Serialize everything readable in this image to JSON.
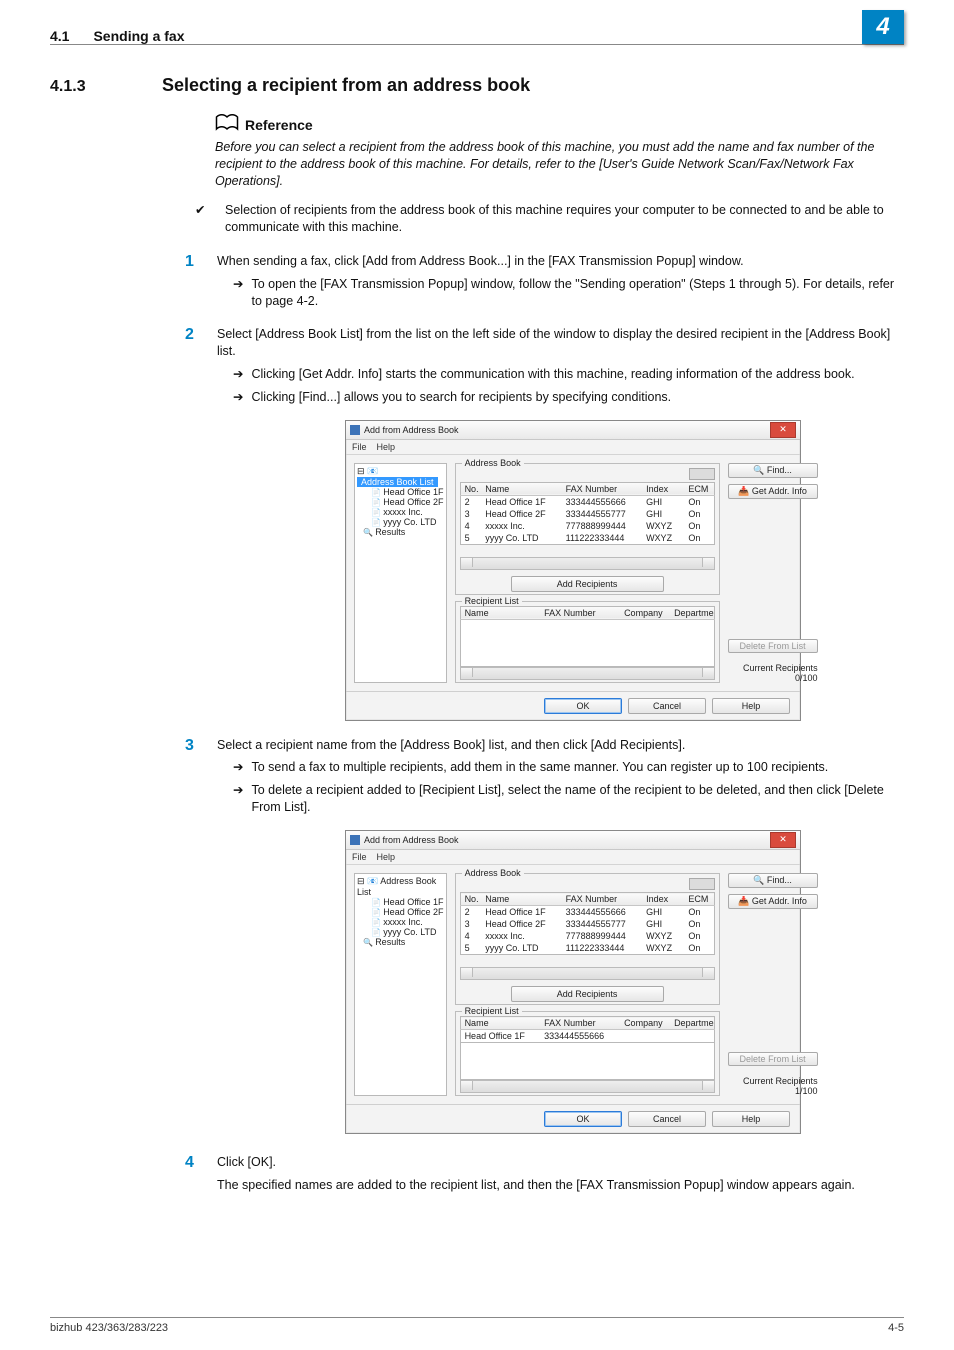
{
  "header": {
    "section_no": "4.1",
    "section_title": "Sending a fax",
    "chapter_badge": "4"
  },
  "section": {
    "number": "4.1.3",
    "title": "Selecting a recipient from an address book"
  },
  "reference": {
    "label": "Reference",
    "body": "Before you can select a recipient from the address book of this machine, you must add the name and fax number of the recipient to the address book of this machine. For details, refer to the [User's Guide Network Scan/Fax/Network Fax Operations]."
  },
  "bullet": {
    "text": "Selection of recipients from the address book of this machine requires your computer to be connected to and be able to communicate with this machine."
  },
  "steps": {
    "s1": {
      "num": "1",
      "text": "When sending a fax, click [Add from Address Book...] in the [FAX Transmission Popup] window.",
      "sub1": "To open the [FAX Transmission Popup] window, follow the \"Sending operation\" (Steps 1 through 5). For details, refer to page 4-2."
    },
    "s2": {
      "num": "2",
      "text": "Select [Address Book List] from the list on the left side of the window to display the desired recipient in the [Address Book] list.",
      "sub1": "Clicking [Get Addr. Info] starts the communication with this machine, reading information of the address book.",
      "sub2": "Clicking [Find...] allows you to search for recipients by specifying conditions."
    },
    "s3": {
      "num": "3",
      "text": "Select a recipient name from the [Address Book] list, and then click [Add Recipients].",
      "sub1": "To send a fax to multiple recipients, add them in the same manner. You can register up to 100 recipients.",
      "sub2": "To delete a recipient added to [Recipient List], select the name of the recipient to be deleted, and then click [Delete From List]."
    },
    "s4": {
      "num": "4",
      "text": "Click [OK].",
      "body": "The specified names are added to the recipient list, and then the [FAX Transmission Popup] window appears again."
    }
  },
  "dialog_common": {
    "title": "Add from Address Book",
    "menu": {
      "file": "File",
      "help": "Help"
    },
    "tree": {
      "root": "Address Book List",
      "items": [
        "Head Office 1F",
        "Head Office 2F",
        "xxxxx Inc.",
        "yyyy Co. LTD"
      ],
      "results": "Results"
    },
    "group_address": "Address Book",
    "group_recipient": "Recipient List",
    "cols_addr": {
      "no": "No.",
      "name": "Name",
      "fax": "FAX Number",
      "index": "Index",
      "ecm": "ECM"
    },
    "cols_recip": {
      "name": "Name",
      "fax": "FAX Number",
      "company": "Company",
      "dept": "Departmen"
    },
    "rows": [
      {
        "no": "2",
        "name": "Head Office 1F",
        "fax": "333444555666",
        "index": "GHI",
        "ecm": "On"
      },
      {
        "no": "3",
        "name": "Head Office 2F",
        "fax": "333444555777",
        "index": "GHI",
        "ecm": "On"
      },
      {
        "no": "4",
        "name": "xxxxx Inc.",
        "fax": "777888999444",
        "index": "WXYZ",
        "ecm": "On"
      },
      {
        "no": "5",
        "name": "yyyy Co. LTD",
        "fax": "111222333444",
        "index": "WXYZ",
        "ecm": "On"
      }
    ],
    "buttons": {
      "find": "Find...",
      "get_addr": "Get Addr. Info",
      "add_recip": "Add Recipients",
      "delete": "Delete From List",
      "ok": "OK",
      "cancel": "Cancel",
      "help": "Help"
    },
    "current_label": "Current Recipients"
  },
  "dialog_a": {
    "current_count": "0/100",
    "recipient_rows": []
  },
  "dialog_b": {
    "current_count": "1/100",
    "recipient_rows": [
      {
        "name": "Head Office 1F",
        "fax": "333444555666"
      }
    ]
  },
  "footer": {
    "left": "bizhub 423/363/283/223",
    "right": "4-5"
  }
}
